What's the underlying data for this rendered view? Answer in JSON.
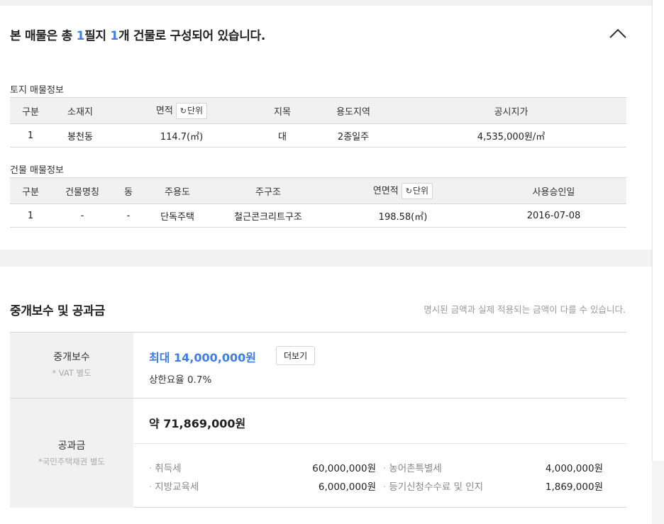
{
  "summary": {
    "prefix": "본 매물은 총 ",
    "land_count": "1",
    "mid": "필지 ",
    "building_count": "1",
    "suffix": "개 건물로 구성되어 있습니다."
  },
  "land": {
    "section_label": "토지 매물정보",
    "headers": [
      "구분",
      "소재지",
      "면적",
      "지목",
      "용도지역",
      "공시지가"
    ],
    "unit_button": "단위",
    "row": [
      "1",
      "봉천동",
      "114.7(㎡)",
      "대",
      "2종일주",
      "4,535,000원/㎡"
    ]
  },
  "building": {
    "section_label": "건물 매물정보",
    "headers": [
      "구분",
      "건물명칭",
      "동",
      "주용도",
      "주구조",
      "연면적",
      "사용승인일"
    ],
    "unit_button": "단위",
    "row": [
      "1",
      "-",
      "-",
      "단독주택",
      "철근콘크리트구조",
      "198.58(㎡)",
      "2016-07-08"
    ]
  },
  "fees": {
    "title": "중개보수 및 공과금",
    "note": "명시된 금액과 실제 적용되는 금액이 다를 수 있습니다.",
    "brokerage": {
      "label": "중개보수",
      "sublabel": "* VAT 별도",
      "max": "최대 14,000,000원",
      "more_button": "더보기",
      "rate": "상한요율 0.7%"
    },
    "public": {
      "label": "공과금",
      "sublabel": "*국민주택채권 별도",
      "total": "약 71,869,000원",
      "items": [
        {
          "name": "취득세",
          "value": "60,000,000원"
        },
        {
          "name": "농어촌특별세",
          "value": "4,000,000원"
        },
        {
          "name": "지방교육세",
          "value": "6,000,000원"
        },
        {
          "name": "등기신청수수료 및 인지",
          "value": "1,869,000원"
        }
      ]
    }
  },
  "colors": {
    "accent": "#3f7ee8",
    "header_bg": "#f1f1f1"
  },
  "icons": {
    "collapse": "chevron-up-icon",
    "refresh": "refresh-icon"
  }
}
